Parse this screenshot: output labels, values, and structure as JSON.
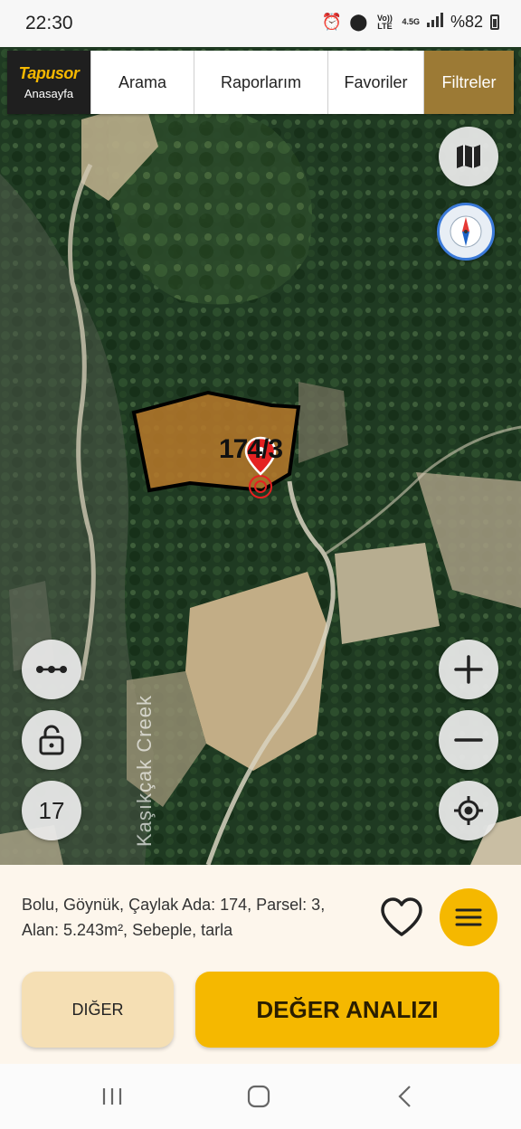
{
  "status_bar": {
    "time": "22:30",
    "network_top": "Vo)) LTE",
    "network_type": "4.5G",
    "battery": "%82"
  },
  "nav": {
    "brand": "Tapusor",
    "brand_sub": "Anasayfa",
    "tabs": [
      {
        "label": "Arama"
      },
      {
        "label": "Raporlarım"
      },
      {
        "label": "Favoriler"
      },
      {
        "label": "Filtreler",
        "active": true
      }
    ]
  },
  "map": {
    "creek_label": "Kaşıkçak Creek",
    "parcel_label": "174/3",
    "zoom_level": "17",
    "icons": {
      "layers": "map-layers-icon",
      "compass": "compass-icon",
      "measure": "measure-icon",
      "lock": "unlock-icon",
      "zoom_in": "plus-icon",
      "zoom_out": "minus-icon",
      "locate": "crosshair-icon",
      "pin": "location-pin-icon"
    }
  },
  "info": {
    "parcel_text": "Bolu, Göynük, Çaylak Ada: 174, Parsel: 3, Alan: 5.243m², Sebeple, tarla"
  },
  "actions": {
    "other_label": "DIĞER",
    "analysis_label": "DEĞER ANALIZI"
  },
  "colors": {
    "accent": "#f5b800",
    "active_tab": "#9c7a35",
    "secondary_button": "#f5dfb4",
    "parcel_fill": "#b8792a",
    "pin": "#e52121"
  }
}
